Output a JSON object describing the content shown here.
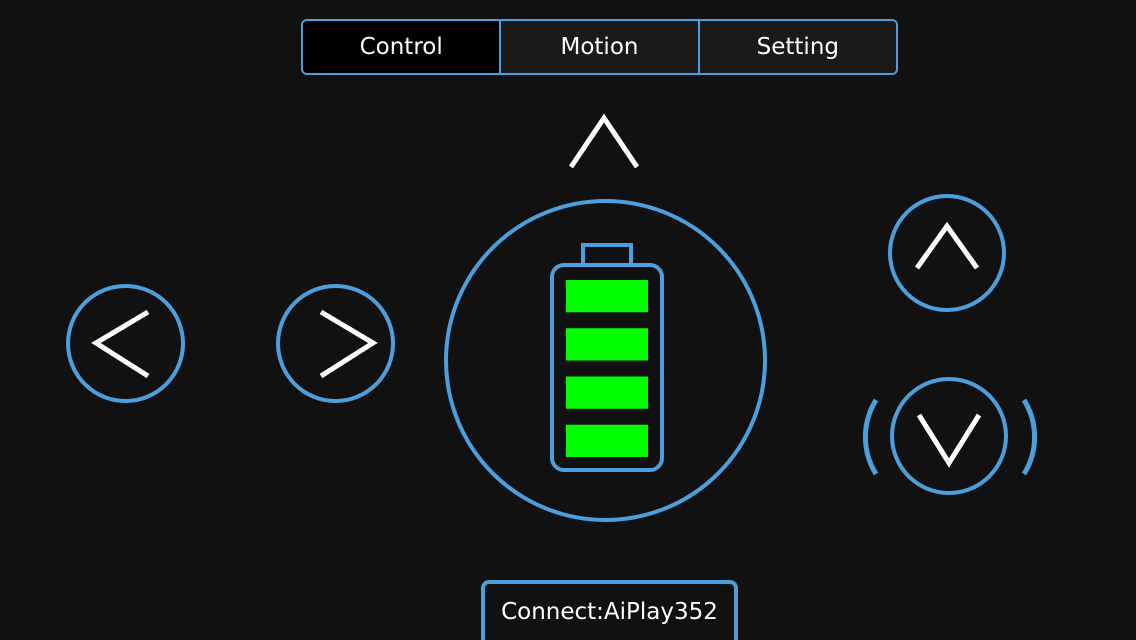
{
  "tabs": [
    {
      "label": "Control",
      "active": true
    },
    {
      "label": "Motion",
      "active": false
    },
    {
      "label": "Setting",
      "active": false
    }
  ],
  "status": {
    "connect_label": "Connect:AiPlay352"
  },
  "battery": {
    "level_fraction": 1.0,
    "filled_bars": 4,
    "total_bars": 4,
    "bar_color": "#00ff00"
  },
  "icons": {
    "top": "chevron-up-icon",
    "left": "chevron-left-icon",
    "right": "chevron-right-icon",
    "center": "battery-icon",
    "right_top": "chevron-up-icon",
    "right_bottom": "chevron-down-icon"
  },
  "colors": {
    "background": "#111111",
    "accent": "#4a9fdc",
    "icon": "#ffffff",
    "battery": "#00ff00"
  }
}
